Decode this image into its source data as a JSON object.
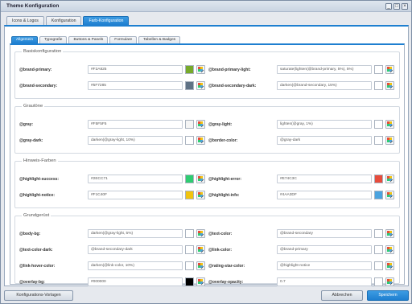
{
  "window": {
    "title": "Theme Konfiguration"
  },
  "window_buttons": [
    "_",
    "□",
    "×"
  ],
  "main_tabs": [
    "Icons & Logos",
    "Konfiguration",
    "Farb-Konfiguration"
  ],
  "sub_tabs": [
    "Allgemein",
    "Typografie",
    "Buttons & Panels",
    "Formulare",
    "Tabellen & Badges"
  ],
  "sections": [
    {
      "legend": "Basiskonfiguration",
      "fields": [
        {
          "label": "@brand-primary:",
          "value": "#F2A825",
          "swatch": "#77aa2a"
        },
        {
          "label": "@brand-primary-light:",
          "value": "saturate(lighten(@brand-primary, 5%), 5%)",
          "swatch": ""
        },
        {
          "label": "@brand-secondary:",
          "value": "#5F7285",
          "swatch": "#5f7285"
        },
        {
          "label": "@brand-secondary-dark:",
          "value": "darken(@brand-secondary, 15%)",
          "swatch": ""
        }
      ]
    },
    {
      "legend": "Grautöne",
      "fields": [
        {
          "label": "@gray:",
          "value": "#F5F5F5",
          "swatch": "#f5f5f5"
        },
        {
          "label": "@gray-light:",
          "value": "lighten(@gray, 1%)",
          "swatch": ""
        },
        {
          "label": "@gray-dark:",
          "value": "darken(@gray-light, 10%)",
          "swatch": ""
        },
        {
          "label": "@border-color:",
          "value": "@gray-dark",
          "swatch": ""
        }
      ]
    },
    {
      "legend": "Hinweis-Farben",
      "fields": [
        {
          "label": "@highlight-success:",
          "value": "#2ECC71",
          "swatch": "#2ecc71"
        },
        {
          "label": "@highlight-error:",
          "value": "#E74C3C",
          "swatch": "#e74c3c"
        },
        {
          "label": "@highlight-notice:",
          "value": "#F1C40F",
          "swatch": "#f1c40f"
        },
        {
          "label": "@highlight-info:",
          "value": "#4AA3DF",
          "swatch": "#4aa3df"
        }
      ]
    },
    {
      "legend": "Grundgerüst",
      "fields": [
        {
          "label": "@body-bg:",
          "value": "darken(@gray-light, 5%)",
          "swatch": ""
        },
        {
          "label": "@text-color:",
          "value": "@brand-secondary",
          "swatch": ""
        },
        {
          "label": "@text-color-dark:",
          "value": "@brand-secondary-dark",
          "swatch": ""
        },
        {
          "label": "@link-color:",
          "value": "@brand-primary",
          "swatch": ""
        },
        {
          "label": "@link-hover-color:",
          "value": "darken(@link-color, 10%)",
          "swatch": ""
        },
        {
          "label": "@rating-star-color:",
          "value": "@highlight-notice",
          "swatch": ""
        },
        {
          "label": "@overlay-bg:",
          "value": "#000000",
          "swatch": "#000000"
        },
        {
          "label": "@overlay-opacity:",
          "value": "0.7",
          "swatch": ""
        }
      ]
    }
  ],
  "footer": {
    "templates": "Konfigurations-Vorlagen",
    "cancel": "Abbrechen",
    "save": "Speichern"
  },
  "colors": {
    "accent": "#1e7fd0"
  }
}
